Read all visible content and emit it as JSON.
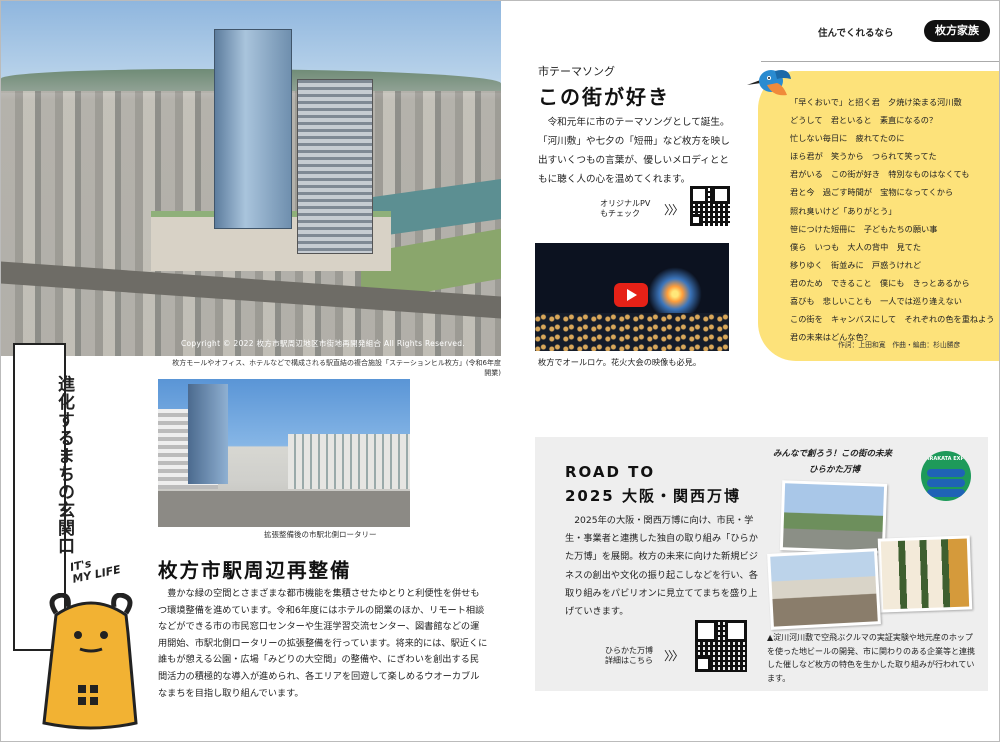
{
  "left": {
    "hero_copyright": "Copyright © 2022 枚方市駅周辺地区市街地再開発組合 All Rights Reserved.",
    "hero_caption": "枚方モールやオフィス、ホテルなどで構成される駅直結の複合施設「ステーションヒル枚方」(令和6年度開業)",
    "vertical_title": "進化するまちの玄関口",
    "photo2_caption": "拡張整備後の市駅北側ロータリー",
    "section_title": "枚方市駅周辺再整備",
    "section_body": "豊かな緑の空間とさまざまな都市機能を集積させたゆとりと利便性を併せもつ環境整備を進めています。令和6年度にはホテルの開業のほか、リモート相談などができる市の市民窓口センターや生涯学習交流センター、図書館などの運用開始、市駅北側ロータリーの拡張整備を行っています。将来的には、駅近くに誰もが憩える公園・広場「みどりの大空間」の整備や、にぎわいを創出する民間活力の積極的な導入が進められ、各エリアを回遊して楽しめるウオーカブルなまちを目指し取り組んでいます。",
    "mascot_text_1": "IT's",
    "mascot_text_2": "MY LIFE"
  },
  "right": {
    "header_text": "住んでくれるなら",
    "header_badge": "枚方家族",
    "song_subtitle": "市テーマソング",
    "song_title": "この街が好き",
    "song_body": "令和元年に市のテーマソングとして誕生。「河川敷」や七夕の「短冊」など枚方を映し出すいくつもの言葉が、優しいメロディとともに聴く人の心を温めてくれます。",
    "pv_label_1": "オリジナルPV",
    "pv_label_2": "もチェック",
    "arrow": "〉〉〉",
    "video_caption": "枚方でオールロケ。花火大会の映像も必見。",
    "lyrics": "「早くおいで」と招く君　夕焼け染まる河川敷\nどうして　君といると　素直になるの？\n忙しない毎日に　疲れてたのに\nほら君が　笑うから　つられて笑ってた\n君がいる　この街が好き　特別なものはなくても\n君と今　過ごす時間が　宝物になってくから\n照れ臭いけど「ありがとう」\n笹につけた短冊に　子どもたちの願い事\n僕ら　いつも　大人の背中　見てた\n移りゆく　街並みに　戸惑うけれど\n君のため　できること　僕にも　きっとあるから\n喜びも　悲しいことも　一人では巡り逢えない\nこの街を　キャンバスにして　それぞれの色を重ねよう\n君の未来はどんな色？",
    "credits": "作詞：上田和寛　作曲・編曲：杉山勝彦",
    "expo": {
      "title_1": "ROAD TO",
      "title_2": "2025 大阪・関西万博",
      "body": "2025年の大阪・関西万博に向け、市民・学生・事業者と連携した独自の取り組み「ひらかた万博」を展開。枚方の未来に向けた新規ビジネスの創出や文化の振り起こしなどを行い、各取り組みをパビリオンに見立ててまちを盛り上げていきます。",
      "qr_label_1": "ひらかた万博",
      "qr_label_2": "詳細はこちら",
      "slogan_1": "みんなで創ろう！この街の未来",
      "slogan_2": "ひらかた万博",
      "logo_text": "HIRAKATA EXPO",
      "photo_caption": "▲淀川河川敷で空飛ぶクルマの実証実験や地元産のホップを使った地ビールの開発、市に関わりのある企業等と連携した催しなど枚方の特色を生かした取り組みが行われています。"
    }
  },
  "colors": {
    "lyrics_bg": "#fde27a",
    "expo_box_bg": "#eeeeee",
    "mascot": "#f2b233",
    "youtube_red": "#e62117",
    "logo_green": "#1e9a5a",
    "logo_blue": "#1f63b6"
  }
}
